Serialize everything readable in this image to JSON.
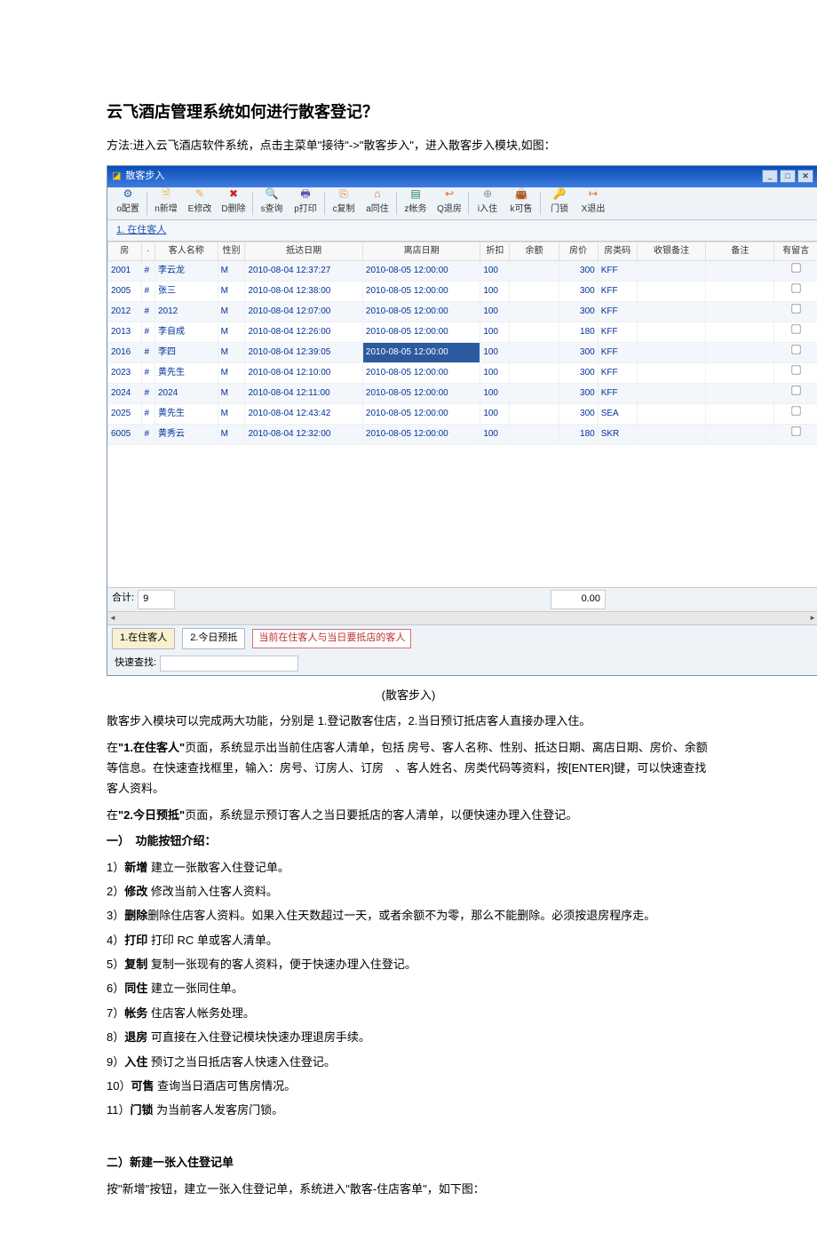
{
  "doc": {
    "title": "云飞酒店管理系统如何进行散客登记？",
    "intro": "方法:进入云飞酒店软件系统，点击主菜单\"接待\"->\"散客步入\"，进入散客步入模块,如图：",
    "caption": "(散客步入)",
    "p1_1": "散客步入模块可以完成两大功能，分别是 1.登记散客住店，2.当日预订抵店客人直接办理入住。",
    "p2_prefix": "在",
    "p2_bold": "\"1.在住客人\"",
    "p2_suffix": "页面，系统显示出当前住店客人清单，包括 房号、客人名称、性别、抵达日期、离店日期、房价、余额等信息。在快速查找框里，输入：房号、订房人、订房　、客人姓名、房类代码等资料，按[ENTER]键，可以快速查找客人资料。",
    "p3_prefix": "在",
    "p3_bold": "\"2.今日预抵\"",
    "p3_suffix": "页面，系统显示预订客人之当日要抵店的客人清单，以便快速办理入住登记。",
    "section1_title": "一）　功能按钮介绍：",
    "btn_intro": [
      {
        "n": "1）",
        "b": "新增",
        "t": " 建立一张散客入住登记单。"
      },
      {
        "n": "2）",
        "b": "修改",
        "t": " 修改当前入住客人资料。"
      },
      {
        "n": "3）",
        "b": "删除",
        "t": "删除住店客人资料。如果入住天数超过一天，或者余额不为零，那么不能删除。必须按退房程序走。"
      },
      {
        "n": "4）",
        "b": "打印",
        "t": " 打印 RC 单或客人清单。"
      },
      {
        "n": "5）",
        "b": "复制",
        "t": " 复制一张现有的客人资料，便于快速办理入住登记。"
      },
      {
        "n": "6）",
        "b": "同住",
        "t": " 建立一张同住单。"
      },
      {
        "n": "7）",
        "b": "帐务",
        "t": " 住店客人帐务处理。"
      },
      {
        "n": "8）",
        "b": "退房",
        "t": " 可直接在入住登记模块快速办理退房手续。"
      },
      {
        "n": "9）",
        "b": "入住",
        "t": " 预订之当日抵店客人快速入住登记。"
      },
      {
        "n": "10）",
        "b": "可售",
        "t": " 查询当日酒店可售房情况。"
      },
      {
        "n": "11）",
        "b": "门锁",
        "t": " 为当前客人发客房门锁。"
      }
    ],
    "section2_title": "二）新建一张入住登记单",
    "p4": "按\"新增\"按钮，建立一张入住登记单，系统进入\"散客-住店客单\"，如下图："
  },
  "app": {
    "window_title": "散客步入",
    "subheader": "1. 在住客人",
    "toolbar": [
      {
        "key": "setting",
        "label": "o配置",
        "icon": "⚙",
        "cls": "ic-gear"
      },
      {
        "sep": true
      },
      {
        "key": "new",
        "label": "n新增",
        "icon": "🗎",
        "cls": "ic-doc"
      },
      {
        "key": "edit",
        "label": "E修改",
        "icon": "✎",
        "cls": "ic-edit"
      },
      {
        "key": "del",
        "label": "D删除",
        "icon": "✖",
        "cls": "ic-del"
      },
      {
        "sep": true
      },
      {
        "key": "find",
        "label": "s查询",
        "icon": "🔍",
        "cls": "ic-find"
      },
      {
        "key": "print",
        "label": "p打印",
        "icon": "🖶",
        "cls": "ic-print"
      },
      {
        "sep": true
      },
      {
        "key": "copy",
        "label": "c复制",
        "icon": "⎘",
        "cls": "ic-copy"
      },
      {
        "key": "room",
        "label": "a同住",
        "icon": "⌂",
        "cls": "ic-room"
      },
      {
        "sep": true
      },
      {
        "key": "acct",
        "label": "z帐务",
        "icon": "▤",
        "cls": "ic-acct"
      },
      {
        "key": "out",
        "label": "Q退房",
        "icon": "↩",
        "cls": "ic-out"
      },
      {
        "sep": true
      },
      {
        "key": "in",
        "label": "i入住",
        "icon": "⊕",
        "cls": "ic-in"
      },
      {
        "key": "avail",
        "label": "k可售",
        "icon": "👜",
        "cls": "ic-avail"
      },
      {
        "sep": true
      },
      {
        "key": "lock",
        "label": "门锁",
        "icon": "🔑",
        "cls": "ic-lock"
      },
      {
        "key": "exit",
        "label": "X退出",
        "icon": "↦",
        "cls": "ic-exit"
      }
    ],
    "columns": [
      "房",
      "·",
      "客人名称",
      "性别",
      "抵达日期",
      "离店日期",
      "折扣",
      "余额",
      "房价",
      "房类码",
      "收银备注",
      "备注",
      "有留言"
    ],
    "rows": [
      {
        "room": "2001",
        "mark": "#",
        "name": "李云龙",
        "sex": "M",
        "arr": "2010-08-04 12:37:27",
        "dep": "2010-08-05 12:00:00",
        "disc": "100",
        "bal": "",
        "price": "300",
        "code": "KFF",
        "hl": false
      },
      {
        "room": "2005",
        "mark": "#",
        "name": "张三",
        "sex": "M",
        "arr": "2010-08-04 12:38:00",
        "dep": "2010-08-05 12:00:00",
        "disc": "100",
        "bal": "",
        "price": "300",
        "code": "KFF",
        "hl": false
      },
      {
        "room": "2012",
        "mark": "#",
        "name": "2012",
        "sex": "M",
        "arr": "2010-08-04 12:07:00",
        "dep": "2010-08-05 12:00:00",
        "disc": "100",
        "bal": "",
        "price": "300",
        "code": "KFF",
        "hl": false
      },
      {
        "room": "2013",
        "mark": "#",
        "name": "李自成",
        "sex": "M",
        "arr": "2010-08-04 12:26:00",
        "dep": "2010-08-05 12:00:00",
        "disc": "100",
        "bal": "",
        "price": "180",
        "code": "KFF",
        "hl": false
      },
      {
        "room": "2016",
        "mark": "#",
        "name": "李四",
        "sex": "M",
        "arr": "2010-08-04 12:39:05",
        "dep": "2010-08-05 12:00:00",
        "disc": "100",
        "bal": "",
        "price": "300",
        "code": "KFF",
        "hl": true
      },
      {
        "room": "2023",
        "mark": "#",
        "name": "黄先生",
        "sex": "M",
        "arr": "2010-08-04 12:10:00",
        "dep": "2010-08-05 12:00:00",
        "disc": "100",
        "bal": "",
        "price": "300",
        "code": "KFF",
        "hl": false
      },
      {
        "room": "2024",
        "mark": "#",
        "name": "2024",
        "sex": "M",
        "arr": "2010-08-04 12:11:00",
        "dep": "2010-08-05 12:00:00",
        "disc": "100",
        "bal": "",
        "price": "300",
        "code": "KFF",
        "hl": false
      },
      {
        "room": "2025",
        "mark": "#",
        "name": "黄先生",
        "sex": "M",
        "arr": "2010-08-04 12:43:42",
        "dep": "2010-08-05 12:00:00",
        "disc": "100",
        "bal": "",
        "price": "300",
        "code": "SEA",
        "hl": false
      },
      {
        "room": "6005",
        "mark": "#",
        "name": "黄秀云",
        "sex": "M",
        "arr": "2010-08-04 12:32:00",
        "dep": "2010-08-05 12:00:00",
        "disc": "100",
        "bal": "",
        "price": "180",
        "code": "SKR",
        "hl": false
      }
    ],
    "total_label": "合计:",
    "total_count": "9",
    "total_bal": "0.00",
    "tabs": {
      "t1": "1.在住客人",
      "t2": "2.今日预抵",
      "note": "当前在住客人与当日要抵店的客人"
    },
    "search_label": "快速查找:"
  }
}
